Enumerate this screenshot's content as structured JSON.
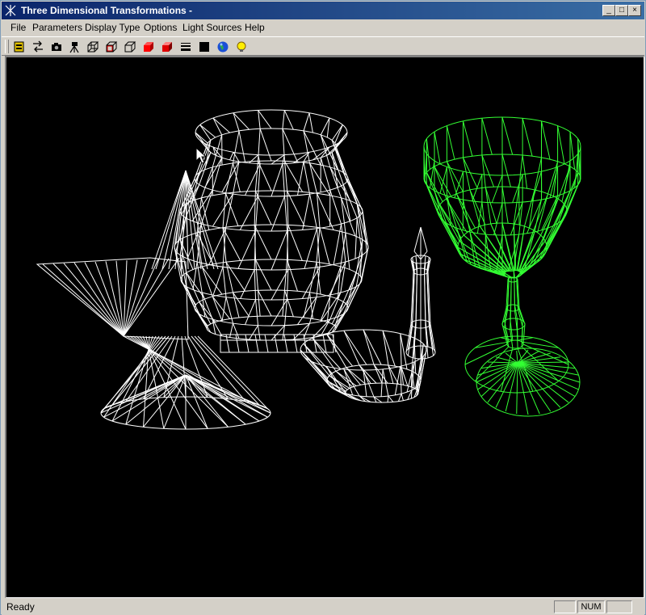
{
  "window": {
    "title": "Three Dimensional Transformations -",
    "title_buttons": [
      "_",
      "□",
      "×"
    ]
  },
  "menu": [
    "File",
    "Parameters",
    "Display Type",
    "Options",
    "Light Sources",
    "Help"
  ],
  "toolbar": {
    "tools": [
      "open-scene-icon",
      "transform-icon",
      "camera-icon",
      "view-camera-icon",
      "wireframe-cube-icon",
      "red-outline-cube-icon",
      "outline-cube-icon",
      "red-solid-cube-icon",
      "red-shaded-cube-icon",
      "line-weight-icon",
      "black-fill-icon",
      "globe-icon",
      "light-bulb-icon"
    ]
  },
  "status": {
    "text": "Ready",
    "panes": [
      "",
      "NUM",
      ""
    ]
  },
  "colors": {
    "titlebar_start": "#0a246a",
    "titlebar_end": "#3a6ea5",
    "viewport_bg": "#000000",
    "wire_white": "#ffffff",
    "wire_green": "#33ff33"
  }
}
